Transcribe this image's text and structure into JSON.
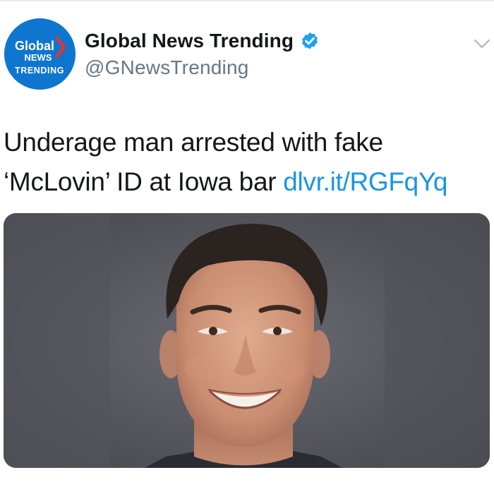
{
  "author": {
    "display_name": "Global News Trending",
    "handle": "@GNewsTrending",
    "verified": true,
    "avatar": {
      "line1": "Global",
      "line2": "NEWS",
      "line3": "TRENDING",
      "bg_color": "#0f76cf",
      "accent_color": "#e8322f"
    }
  },
  "tweet": {
    "text_before_link": "Underage man arrested with fake ‘McLovin’ ID at Iowa bar ",
    "link_text": "dlvr.it/RGFqYq",
    "link_color": "#1b95e0"
  },
  "media": {
    "alt": "mugshot-photo"
  },
  "icons": {
    "verified": "verified-badge-icon",
    "menu": "chevron-down-icon"
  },
  "colors": {
    "verified_badge": "#1da1f2",
    "handle": "#657786",
    "text": "#14171a"
  }
}
